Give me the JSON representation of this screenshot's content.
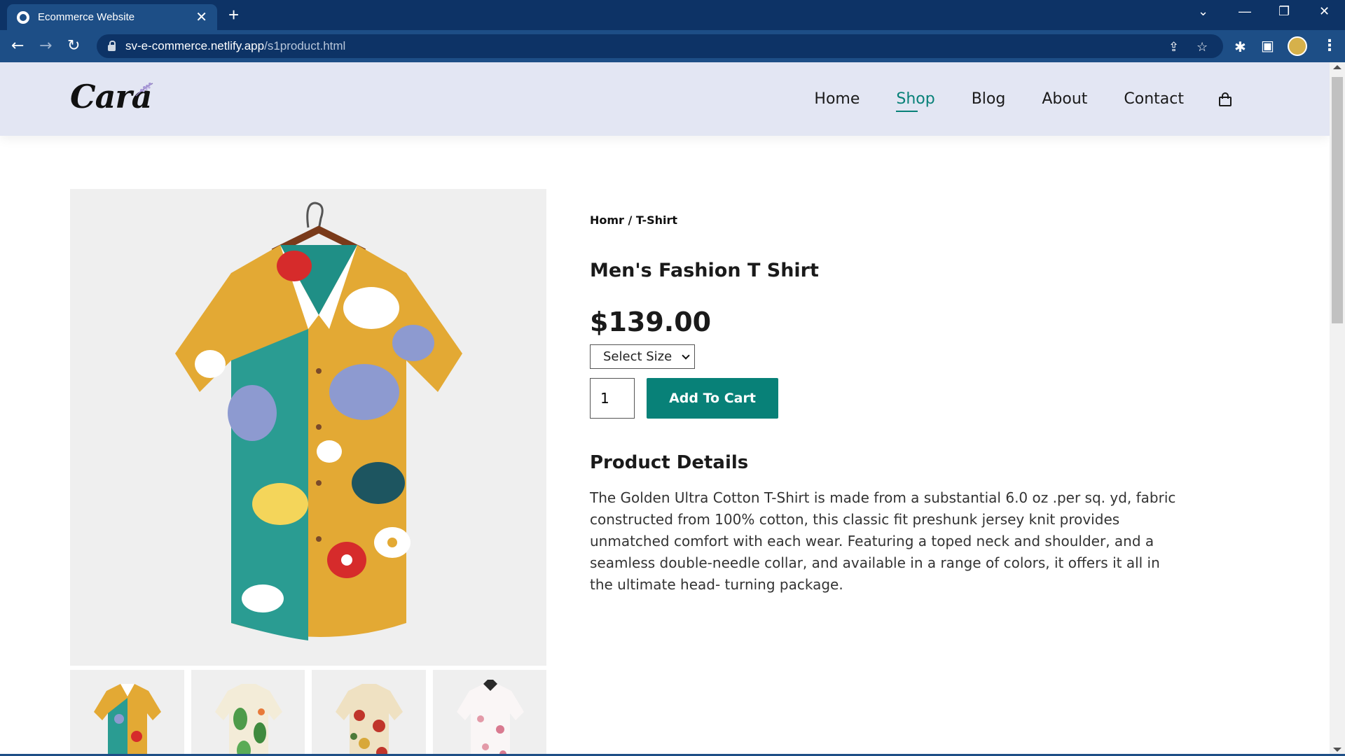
{
  "browser": {
    "tab_title": "Ecommerce Website",
    "tab_close": "✕",
    "new_tab": "+",
    "url_host": "sv-e-commerce.netlify.app",
    "url_path": "/s1product.html",
    "window_controls": {
      "minimize": "—",
      "restore": "❐",
      "close": "✕",
      "tab_search": "⌄"
    }
  },
  "site": {
    "logo_text": "Cara",
    "nav": [
      {
        "label": "Home"
      },
      {
        "label": "Shop"
      },
      {
        "label": "Blog"
      },
      {
        "label": "About"
      },
      {
        "label": "Contact"
      }
    ],
    "active_nav": "Shop",
    "accent_color": "#088178"
  },
  "product": {
    "breadcrumb": "Homr / T-Shirt",
    "title": "Men's Fashion T Shirt",
    "price": "$139.00",
    "size_select": "Select Size",
    "quantity": "1",
    "add_to_cart": "Add To Cart",
    "details_heading": "Product Details",
    "details_text": "The Golden Ultra Cotton T-Shirt is made from a substantial 6.0 oz .per sq. yd, fabric constructed from 100% cotton, this classic fit preshunk jersey knit provides unmatched comfort with each wear. Featuring a toped neck and shoulder, and a seamless double-needle collar, and available in a range of colors, it offers it all in the ultimate head- turning package.",
    "thumbnails": [
      "colorful-floral-shirt",
      "green-leaf-shirt",
      "red-floral-shirt",
      "pink-floral-shirt"
    ]
  }
}
